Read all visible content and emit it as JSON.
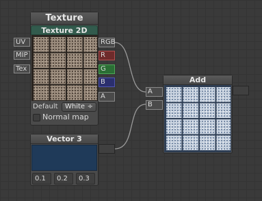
{
  "colors": {
    "canvas": "#3a3a3a",
    "texture_header": "#325b4d",
    "vector_swatch": "#1f3a59",
    "port_red": "#6e2b2b",
    "port_green": "#2b6e35",
    "port_blue": "#2b2f6e"
  },
  "texture_node": {
    "title": "Texture",
    "subheader": "Texture 2D",
    "inputs": [
      "UV",
      "MIP",
      "Tex"
    ],
    "outputs": [
      "RGB",
      "R",
      "G",
      "B",
      "A"
    ],
    "mode_label": "Default",
    "mode_value": "White",
    "mode_arrow": "÷",
    "normal_map_label": "Normal map",
    "normal_map_checked": false,
    "preview_icon": "stone-tile-texture"
  },
  "vector_node": {
    "title": "Vector 3",
    "values": [
      "0.1",
      "0.2",
      "0.3"
    ]
  },
  "add_node": {
    "title": "Add",
    "inputs": [
      "A",
      "B"
    ],
    "preview_icon": "frosted-tile-texture"
  }
}
